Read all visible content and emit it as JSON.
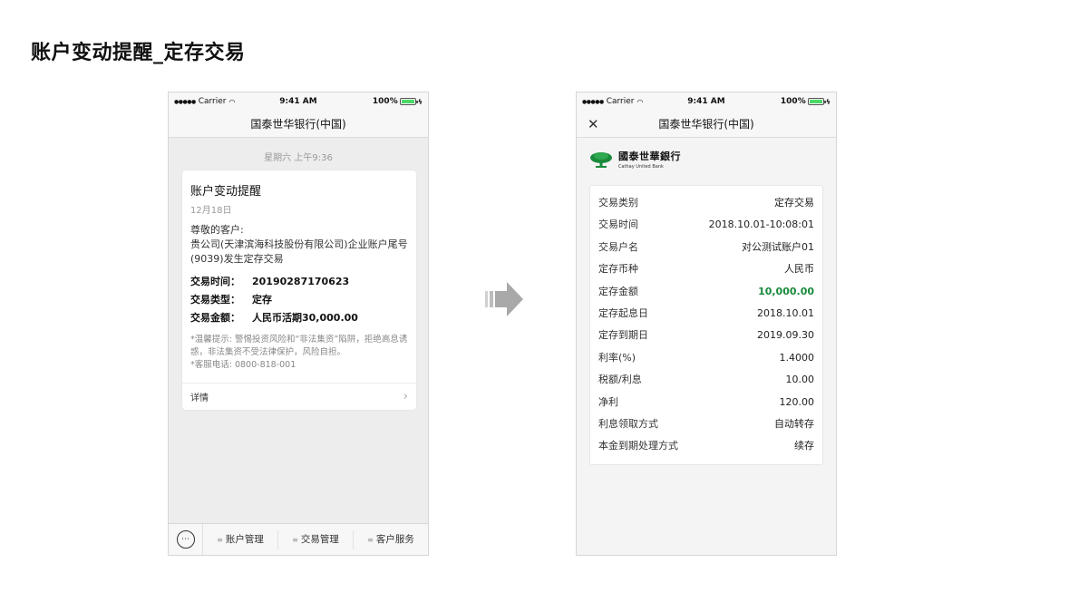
{
  "page_title": "账户变动提醒_定存交易",
  "status_bar": {
    "carrier": "Carrier",
    "time": "9:41 AM",
    "battery": "100%"
  },
  "left_phone": {
    "nav_title": "国泰世华银行(中国)",
    "timestamp": "星期六 上午9:36",
    "message": {
      "title": "账户变动提醒",
      "date": "12月18日",
      "greeting": "尊敬的客户:",
      "body": "贵公司(天津滨海科技股份有限公司)企业账户尾号(9039)发生定存交易",
      "fields": [
        {
          "label": "交易时间：",
          "value": "20190287170623"
        },
        {
          "label": "交易类型：",
          "value": "定存"
        },
        {
          "label": "交易金额：",
          "value": "人民币活期30,000.00"
        }
      ],
      "note1": "*温馨提示: 警惕投资风险和“非法集资”陷阱，拒绝高息诱惑，非法集资不受法律保护，风险自担。",
      "note2": "*客服电话: 0800-818-001",
      "detail_label": "详情"
    },
    "menu": [
      "账户管理",
      "交易管理",
      "客户服务"
    ]
  },
  "right_phone": {
    "nav_title": "国泰世华银行(中国)",
    "logo": {
      "cn": "國泰世華銀行",
      "en": "Cathay United Bank"
    },
    "rows": [
      {
        "label": "交易类别",
        "value": "定存交易"
      },
      {
        "label": "交易时间",
        "value": "2018.10.01-10:08:01"
      },
      {
        "label": "交易户名",
        "value": "对公测试账户01"
      },
      {
        "label": "定存币种",
        "value": "人民币"
      },
      {
        "label": "定存金额",
        "value": "10,000.00",
        "highlight": true
      },
      {
        "label": "定存起息日",
        "value": "2018.10.01"
      },
      {
        "label": "定存到期日",
        "value": "2019.09.30"
      },
      {
        "label": "利率(%)",
        "value": "1.4000"
      },
      {
        "label": "税额/利息",
        "value": "10.00"
      },
      {
        "label": "净利",
        "value": "120.00"
      },
      {
        "label": "利息领取方式",
        "value": "自动转存"
      },
      {
        "label": "本金到期处理方式",
        "value": "续存"
      }
    ]
  },
  "colors": {
    "accent_green": "#1a8a3c",
    "battery_green": "#4cd964",
    "arrow_gray": "#a9a9a9"
  }
}
